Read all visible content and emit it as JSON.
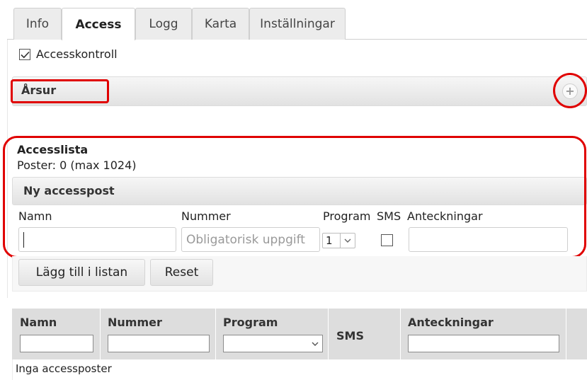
{
  "tabs": [
    "Info",
    "Access",
    "Logg",
    "Karta",
    "Inställningar"
  ],
  "access_control": {
    "label": "Accesskontroll",
    "checked": true
  },
  "arsur": {
    "title": "Årsur",
    "expand_icon": "plus-icon"
  },
  "accesslista": {
    "title": "Accesslista",
    "count": "Poster: 0 (max 1024)"
  },
  "ny_accesspost": {
    "title": "Ny accesspost",
    "labels": {
      "namn": "Namn",
      "nummer": "Nummer",
      "program": "Program",
      "sms": "SMS",
      "anteckningar": "Anteckningar"
    },
    "namn_value": "",
    "nummer_placeholder": "Obligatorisk uppgift",
    "program_value": "1",
    "sms_checked": false,
    "anteckningar_value": ""
  },
  "buttons": {
    "add": "Lägg till i listan",
    "reset": "Reset"
  },
  "table": {
    "headers": [
      "Namn",
      "Nummer",
      "Program",
      "SMS",
      "Anteckningar"
    ],
    "empty_message": "Inga accessposter"
  },
  "colors": {
    "highlight": "#e00000",
    "bar": "#e2e2e2",
    "table_header": "#dddddd"
  }
}
